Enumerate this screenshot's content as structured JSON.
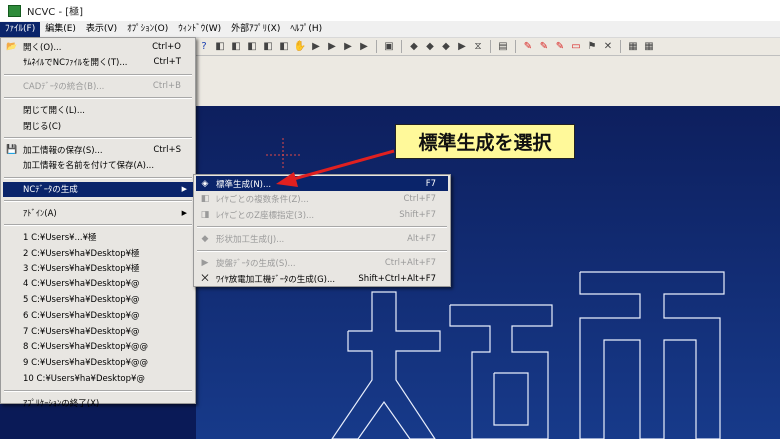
{
  "window": {
    "title": "NCVC - [極]"
  },
  "menubar": [
    {
      "label": "ﾌｧｲﾙ(F)",
      "active": true
    },
    {
      "label": "編集(E)",
      "active": false
    },
    {
      "label": "表示(V)",
      "active": false
    },
    {
      "label": "ｵﾌﾟｼｮﾝ(O)",
      "active": false
    },
    {
      "label": "ｳｨﾝﾄﾞｳ(W)",
      "active": false
    },
    {
      "label": "外部ｱﾌﾟﾘ(X)",
      "active": false
    },
    {
      "label": "ﾍﾙﾌﾟ(H)",
      "active": false
    }
  ],
  "file_menu": [
    {
      "icon": "open-folder-icon",
      "label": "開く(O)...",
      "shortcut": "Ctrl+O",
      "disabled": false
    },
    {
      "icon": "",
      "label": "ｻﾑﾈｲﾙでNCﾌｧｲﾙを開く(T)...",
      "shortcut": "Ctrl+T",
      "disabled": false
    },
    {
      "sep": true
    },
    {
      "icon": "",
      "label": "CADﾃﾞｰﾀの統合(B)...",
      "shortcut": "Ctrl+B",
      "disabled": true
    },
    {
      "sep": true
    },
    {
      "icon": "",
      "label": "閉じて開く(L)...",
      "shortcut": "",
      "disabled": false
    },
    {
      "icon": "",
      "label": "閉じる(C)",
      "shortcut": "",
      "disabled": false
    },
    {
      "sep": true
    },
    {
      "icon": "save-icon",
      "label": "加工情報の保存(S)...",
      "shortcut": "Ctrl+S",
      "disabled": false
    },
    {
      "icon": "",
      "label": "加工情報を名前を付けて保存(A)...",
      "shortcut": "",
      "disabled": false
    },
    {
      "sep": true
    },
    {
      "icon": "",
      "label": "NCﾃﾞｰﾀの生成",
      "shortcut": "",
      "disabled": false,
      "highlight": true,
      "submenu": true
    },
    {
      "sep": true
    },
    {
      "icon": "",
      "label": "ｱﾄﾞｲﾝ(A)",
      "shortcut": "",
      "disabled": false,
      "submenu": true
    },
    {
      "sep": true
    },
    {
      "icon": "",
      "label": "1 C:¥Users¥...¥極",
      "shortcut": "",
      "disabled": false
    },
    {
      "icon": "",
      "label": "2 C:¥Users¥ha¥Desktop¥極",
      "shortcut": "",
      "disabled": false
    },
    {
      "icon": "",
      "label": "3 C:¥Users¥ha¥Desktop¥極",
      "shortcut": "",
      "disabled": false
    },
    {
      "icon": "",
      "label": "4 C:¥Users¥ha¥Desktop¥@",
      "shortcut": "",
      "disabled": false
    },
    {
      "icon": "",
      "label": "5 C:¥Users¥ha¥Desktop¥@",
      "shortcut": "",
      "disabled": false
    },
    {
      "icon": "",
      "label": "6 C:¥Users¥ha¥Desktop¥@",
      "shortcut": "",
      "disabled": false
    },
    {
      "icon": "",
      "label": "7 C:¥Users¥ha¥Desktop¥@",
      "shortcut": "",
      "disabled": false
    },
    {
      "icon": "",
      "label": "8 C:¥Users¥ha¥Desktop¥@@",
      "shortcut": "",
      "disabled": false
    },
    {
      "icon": "",
      "label": "9 C:¥Users¥ha¥Desktop¥@@",
      "shortcut": "",
      "disabled": false
    },
    {
      "icon": "",
      "label": "10 C:¥Users¥ha¥Desktop¥@",
      "shortcut": "",
      "disabled": false
    },
    {
      "sep": true
    },
    {
      "icon": "",
      "label": "ｱﾌﾟﾘｹｰｼｮﾝの終了(X)",
      "shortcut": "",
      "disabled": false
    }
  ],
  "nc_submenu": [
    {
      "icon": "generate-icon",
      "label": "標準生成(N)...",
      "shortcut": "F7",
      "disabled": false,
      "highlight": true
    },
    {
      "icon": "layer-icon",
      "label": "ﾚｲﾔごとの複数条件(Z)...",
      "shortcut": "Ctrl+F7",
      "disabled": true
    },
    {
      "icon": "layer-z-icon",
      "label": "ﾚｲﾔごとのZ座標指定(3)...",
      "shortcut": "Shift+F7",
      "disabled": true
    },
    {
      "sep": true
    },
    {
      "icon": "shape-icon",
      "label": "形状加工生成(J)...",
      "shortcut": "Alt+F7",
      "disabled": true
    },
    {
      "sep": true
    },
    {
      "icon": "lathe-icon",
      "label": "旋盤ﾃﾞｰﾀの生成(S)...",
      "shortcut": "Ctrl+Alt+F7",
      "disabled": true
    },
    {
      "icon": "wire-icon",
      "label": "ﾜｲﾔ放電加工機ﾃﾞｰﾀの生成(G)...",
      "shortcut": "Shift+Ctrl+Alt+F7",
      "disabled": false
    }
  ],
  "callout": {
    "text": "標準生成を選択"
  },
  "toolbar_icons": [
    "help-icon",
    "layer-icon",
    "layer-icon",
    "layer-icon",
    "layer-icon",
    "layer-icon",
    "hand-icon",
    "play-icon",
    "play-icon",
    "play-icon",
    "play-icon",
    "separator",
    "view-icon",
    "separator",
    "tool-icon",
    "tool-icon",
    "tool-icon",
    "play-icon",
    "collapse-icon",
    "separator",
    "list-icon",
    "separator",
    "pencil-red-icon",
    "pencil-red-icon",
    "pencil-red-icon",
    "rect-red-icon",
    "flag-icon",
    "close-icon",
    "separator",
    "grid-icon",
    "grid-icon"
  ],
  "colors": {
    "menu_highlight": "#0a246a",
    "callout_bg": "#fff99a",
    "arrow": "#e02020",
    "canvas": "#0d1f5e"
  }
}
